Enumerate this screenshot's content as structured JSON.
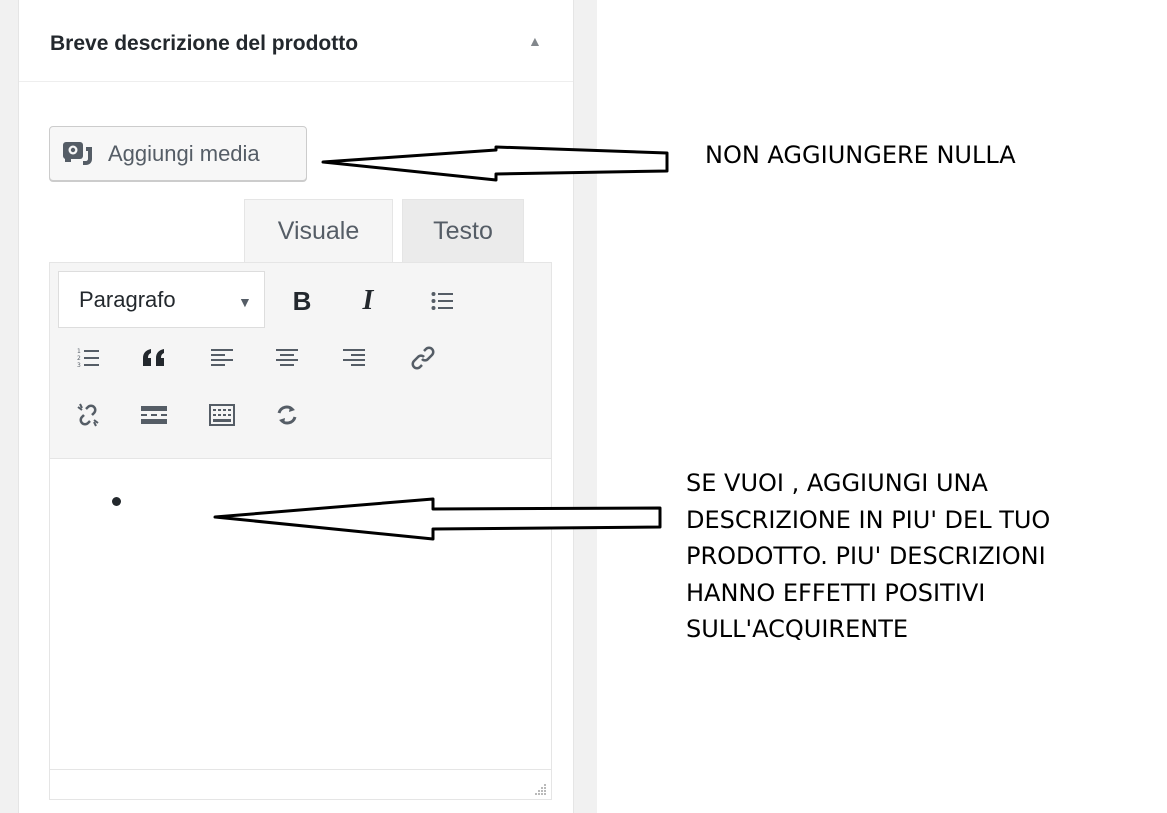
{
  "metabox": {
    "title": "Breve descrizione del prodotto",
    "toggle_icon": "arrow-up-icon"
  },
  "media_button": {
    "label": "Aggiungi media",
    "icon": "add-media-icon"
  },
  "editor_tabs": [
    {
      "label": "Visuale",
      "active": true
    },
    {
      "label": "Testo",
      "active": false
    }
  ],
  "toolbar": {
    "format_select": "Paragrafo",
    "row1": [
      "bold-icon",
      "italic-icon",
      "bulleted-list-icon"
    ],
    "row2": [
      "numbered-list-icon",
      "blockquote-icon",
      "align-left-icon",
      "align-center-icon",
      "align-right-icon",
      "link-icon"
    ],
    "row3": [
      "unlink-icon",
      "read-more-icon",
      "toolbar-toggle-icon",
      "clear-formatting-icon"
    ],
    "bold_glyph": "B",
    "italic_glyph": "I"
  },
  "annotations": {
    "note_1": "NON AGGIUNGERE NULLA",
    "note_2_lines": [
      "SE VUOI , AGGIUNGI UNA",
      "DESCRIZIONE IN PIU' DEL TUO",
      "PRODOTTO. PIU' DESCRIZIONI",
      "HANNO EFFETTI POSITIVI",
      "SULL'ACQUIRENTE"
    ]
  }
}
